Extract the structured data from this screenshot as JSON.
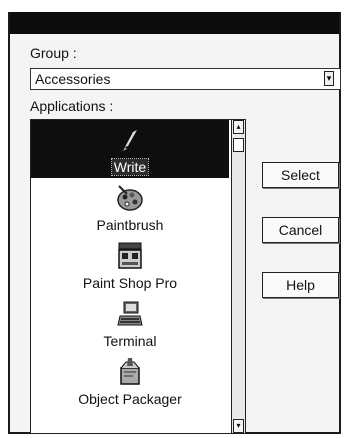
{
  "dialog": {
    "group_label": "Group :",
    "group_value": "Accessories",
    "applications_label": "Applications :"
  },
  "applications": [
    {
      "name": "Write",
      "icon": "pen-icon",
      "selected": true
    },
    {
      "name": "Paintbrush",
      "icon": "palette-icon",
      "selected": false
    },
    {
      "name": "Paint Shop Pro",
      "icon": "paint-shop-icon",
      "selected": false
    },
    {
      "name": "Terminal",
      "icon": "terminal-icon",
      "selected": false
    },
    {
      "name": "Object Packager",
      "icon": "package-icon",
      "selected": false
    }
  ],
  "buttons": {
    "select": "Select",
    "cancel": "Cancel",
    "help": "Help"
  }
}
